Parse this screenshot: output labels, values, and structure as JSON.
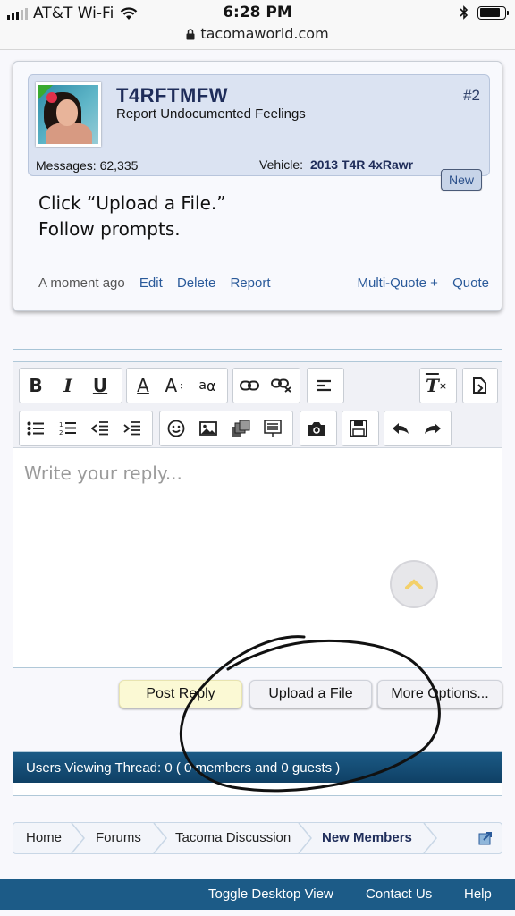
{
  "status_bar": {
    "carrier": "AT&T Wi-Fi",
    "time": "6:28 PM",
    "url": "tacomaworld.com",
    "icons": [
      "signal-icon",
      "wifi-icon",
      "lock-icon",
      "bluetooth-icon",
      "battery-icon"
    ],
    "battery_level": 0.85
  },
  "post": {
    "username": "T4RFTMFW",
    "user_title": "Report Undocumented Feelings",
    "post_number": "#2",
    "messages_label": "Messages:",
    "messages_value": "62,335",
    "vehicle_label": "Vehicle:",
    "vehicle_value": "2013 T4R 4xRawr",
    "badge": "New",
    "body_line1": "Click “Upload a File.”",
    "body_line2": "Follow prompts.",
    "time": "A moment ago",
    "edit": "Edit",
    "delete": "Delete",
    "report": "Report",
    "multiquote": "Multi-Quote +",
    "quote": "Quote"
  },
  "editor": {
    "placeholder": "Write your reply...",
    "toolbar_buttons_row1": [
      "bold",
      "italic",
      "underline",
      "font-color",
      "font-size",
      "font-family",
      "link",
      "unlink",
      "align",
      "remove-format",
      "toggle-bbcode"
    ],
    "toolbar_buttons_row2": [
      "bullet-list",
      "number-list",
      "outdent",
      "indent",
      "smilies",
      "image",
      "media",
      "code",
      "camera",
      "drafts",
      "undo",
      "redo"
    ],
    "bold": "B",
    "italic": "I",
    "underline": "U",
    "fontcolor": "A",
    "fontsize": "A",
    "fontfamily": "a",
    "fontfamily2": "α"
  },
  "buttons": {
    "post_reply": "Post Reply",
    "upload_file": "Upload a File",
    "more_options": "More Options..."
  },
  "users_viewing": {
    "text": "Users Viewing Thread: 0 ( 0 members and 0 guests )"
  },
  "breadcrumb": {
    "items": [
      "Home",
      "Forums",
      "Tacoma Discussion",
      "New Members"
    ]
  },
  "footer": {
    "toggle": "Toggle Desktop View",
    "contact": "Contact Us",
    "help": "Help"
  },
  "colors": {
    "accent": "#1c5b87",
    "link": "#2a5a9a",
    "username": "#1f2d5a",
    "post_reply_bg": "#fbf9d4"
  }
}
